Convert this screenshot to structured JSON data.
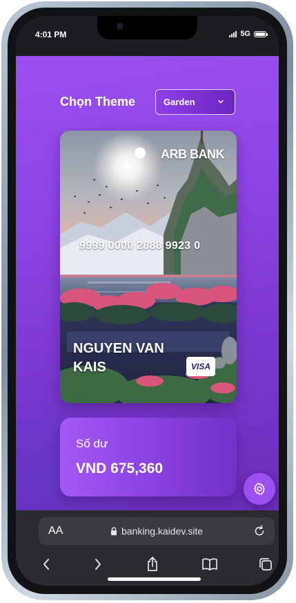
{
  "status_bar": {
    "time": "4:01 PM",
    "network": "5G"
  },
  "page": {
    "theme_label": "Chọn Theme",
    "theme_select": {
      "selected": "Garden"
    },
    "card": {
      "bank_name": "ARB BANK",
      "number": "9999 0000 2888 9923 0",
      "holder": "NGUYEN VAN KAIS",
      "network_logo": "VISA"
    },
    "balance": {
      "label": "Số dư",
      "value": "VND 675,360"
    },
    "settings_button": {
      "icon": "gear-icon"
    }
  },
  "browser": {
    "text_size_label": "AA",
    "url": "banking.kaidev.site",
    "toolbar": [
      "back-icon",
      "forward-icon",
      "share-icon",
      "bookmarks-icon",
      "tabs-icon"
    ]
  },
  "colors": {
    "accent": "#9a4fee",
    "page_bg_top": "#9b4ff0",
    "page_bg_bottom": "#6b2db9"
  }
}
